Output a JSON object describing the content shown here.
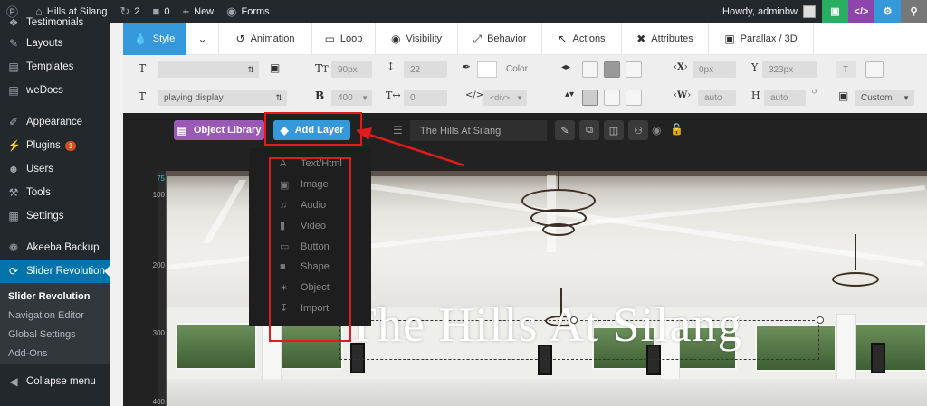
{
  "adminbar": {
    "site_name": "Hills at Silang",
    "updates_count": "2",
    "comments_count": "0",
    "new_label": "New",
    "forms_label": "Forms",
    "howdy": "Howdy, adminbw",
    "icons": [
      "wordpress-icon",
      "home-icon",
      "refresh-icon",
      "comment-icon",
      "plus-icon",
      "forms-icon",
      "save-icon",
      "code-icon",
      "gear-icon",
      "search-icon"
    ],
    "colors": {
      "save": "#27ae60",
      "code": "#8e44ad",
      "gear": "#3498db",
      "search": "#777777"
    }
  },
  "sidebar": {
    "items": [
      {
        "label": "Testimonials",
        "icon": "testimonial-icon"
      },
      {
        "label": "Layouts",
        "icon": "pencil-icon"
      },
      {
        "label": "Templates",
        "icon": "page-icon"
      },
      {
        "label": "weDocs",
        "icon": "doc-icon"
      },
      {
        "label": "Appearance",
        "icon": "brush-icon"
      },
      {
        "label": "Plugins",
        "icon": "plug-icon",
        "badge": "1"
      },
      {
        "label": "Users",
        "icon": "user-icon"
      },
      {
        "label": "Tools",
        "icon": "wrench-icon"
      },
      {
        "label": "Settings",
        "icon": "settings-icon"
      },
      {
        "label": "Akeeba Backup",
        "icon": "akeeba-icon"
      },
      {
        "label": "Slider Revolution",
        "icon": "slider-icon"
      }
    ],
    "submenu": [
      "Slider Revolution",
      "Navigation Editor",
      "Global Settings",
      "Add-Ons"
    ],
    "collapse_label": "Collapse menu"
  },
  "tabs": [
    {
      "label": "Style",
      "icon": "droplet-icon"
    },
    {
      "label": "",
      "icon": "chevron-down-icon"
    },
    {
      "label": "Animation",
      "icon": "history-icon"
    },
    {
      "label": "Loop",
      "icon": "loop-icon"
    },
    {
      "label": "Visibility",
      "icon": "eye-icon"
    },
    {
      "label": "Behavior",
      "icon": "behavior-icon"
    },
    {
      "label": "Actions",
      "icon": "cursor-icon"
    },
    {
      "label": "Attributes",
      "icon": "tools-icon"
    },
    {
      "label": "Parallax / 3D",
      "icon": "image-icon"
    }
  ],
  "toolbar": {
    "font_size": "90px",
    "line_height": "22",
    "color_label": "Color",
    "font_family": "playing display",
    "font_weight": "400",
    "letter_spacing": "0",
    "tag": "<div>",
    "x_value": "0px",
    "y_value": "323px",
    "w_value": "auto",
    "h_value": "auto",
    "size_mode": "Custom",
    "x_label": "X",
    "y_label": "Y",
    "w_label": "W",
    "h_label": "H"
  },
  "layerbar": {
    "object_library": "Object Library",
    "add_layer": "Add Layer",
    "layer_name": "The Hills At Silang"
  },
  "dropdown": [
    {
      "label": "Text/Html",
      "icon": "text-icon"
    },
    {
      "label": "Image",
      "icon": "image-icon"
    },
    {
      "label": "Audio",
      "icon": "music-icon"
    },
    {
      "label": "Video",
      "icon": "video-icon"
    },
    {
      "label": "Button",
      "icon": "button-icon"
    },
    {
      "label": "Shape",
      "icon": "shape-icon"
    },
    {
      "label": "Object",
      "icon": "puzzle-icon"
    },
    {
      "label": "Import",
      "icon": "import-icon"
    }
  ],
  "ruler": [
    "75",
    "100",
    "200",
    "300",
    "400"
  ],
  "slide_title": "The Hills At Silang",
  "highlight_color": "#e01b1b"
}
